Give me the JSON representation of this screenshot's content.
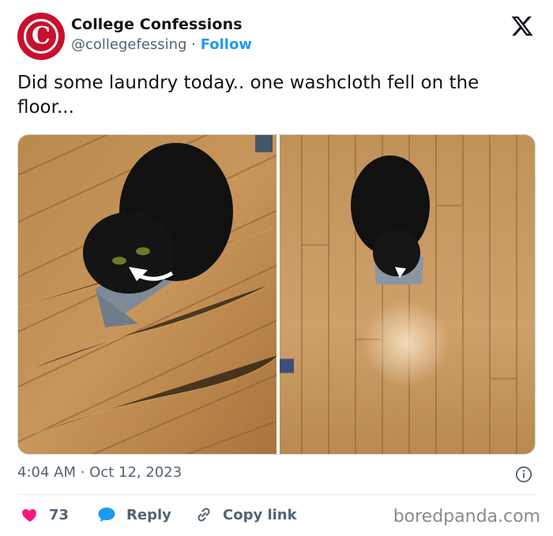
{
  "header": {
    "display_name": "College Confessions",
    "handle": "@collegefessing",
    "separator": "·",
    "follow_label": "Follow",
    "avatar_letter": "C",
    "brand_color": "#c8102e",
    "platform_icon": "x-logo-icon"
  },
  "tweet": {
    "text": "Did some laundry today.. one washcloth fell on the floor..."
  },
  "media": {
    "photos": [
      "cat-on-washcloth-closeup",
      "cat-on-washcloth-wide"
    ]
  },
  "meta": {
    "timestamp": "4:04 AM · Oct 12, 2023",
    "info_icon": "info-icon"
  },
  "actions": {
    "like_count": "73",
    "reply_label": "Reply",
    "copy_link_label": "Copy link",
    "like_color": "#f91880",
    "reply_color": "#1d9bf0"
  },
  "watermark": "boredpanda.com"
}
